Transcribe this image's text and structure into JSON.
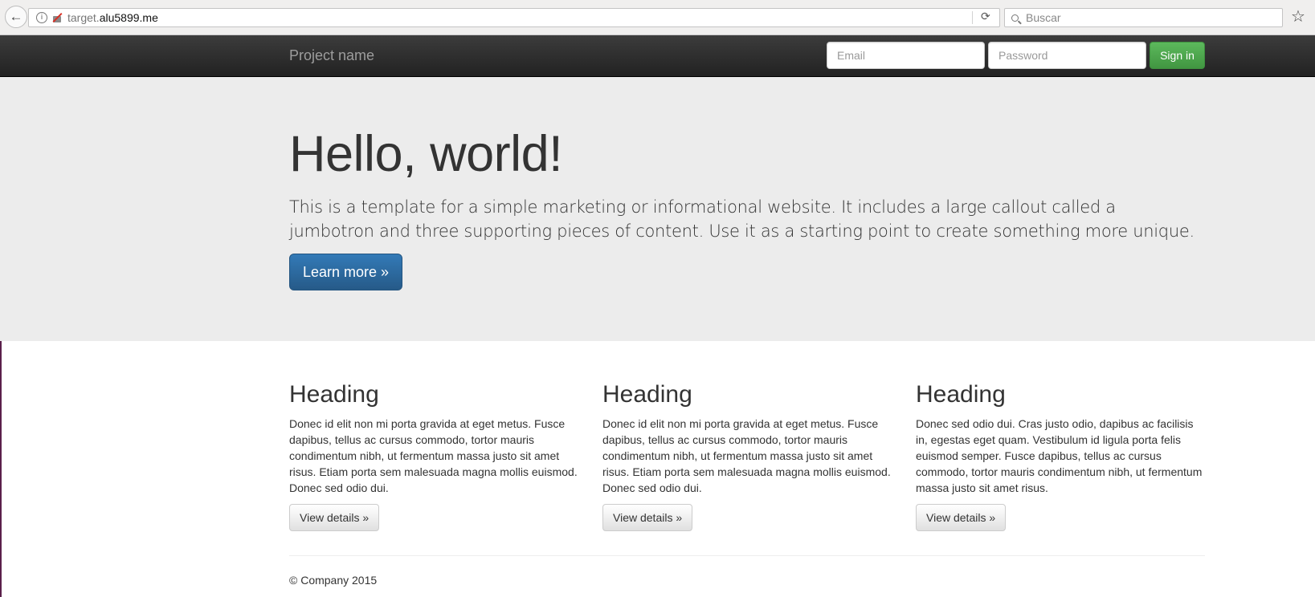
{
  "browser": {
    "url_subdomain": "target.",
    "url_domain": "alu5899.me",
    "search_placeholder": "Buscar",
    "back_icon": "←",
    "reload_icon": "⟳",
    "star_icon": "☆",
    "info_icon": "i"
  },
  "navbar": {
    "brand": "Project name",
    "email_placeholder": "Email",
    "password_placeholder": "Password",
    "signin_label": "Sign in"
  },
  "jumbotron": {
    "title": "Hello, world!",
    "text": "This is a template for a simple marketing or informational website. It includes a large callout called a jumbotron and three supporting pieces of content. Use it as a starting point to create something more unique.",
    "button_label": "Learn more »"
  },
  "columns": [
    {
      "heading": "Heading",
      "text": "Donec id elit non mi porta gravida at eget metus. Fusce dapibus, tellus ac cursus commodo, tortor mauris condimentum nibh, ut fermentum massa justo sit amet risus. Etiam porta sem malesuada magna mollis euismod. Donec sed odio dui.",
      "button_label": "View details »"
    },
    {
      "heading": "Heading",
      "text": "Donec id elit non mi porta gravida at eget metus. Fusce dapibus, tellus ac cursus commodo, tortor mauris condimentum nibh, ut fermentum massa justo sit amet risus. Etiam porta sem malesuada magna mollis euismod. Donec sed odio dui.",
      "button_label": "View details »"
    },
    {
      "heading": "Heading",
      "text": "Donec sed odio dui. Cras justo odio, dapibus ac facilisis in, egestas eget quam. Vestibulum id ligula porta felis euismod semper. Fusce dapibus, tellus ac cursus commodo, tortor mauris condimentum nibh, ut fermentum massa justo sit amet risus.",
      "button_label": "View details »"
    }
  ],
  "footer": {
    "text": "© Company 2015"
  },
  "colors": {
    "navbar_bg": "#222222",
    "jumbotron_bg": "#ececec",
    "signin_green": "#5cb85c",
    "primary_blue": "#337ab7"
  }
}
